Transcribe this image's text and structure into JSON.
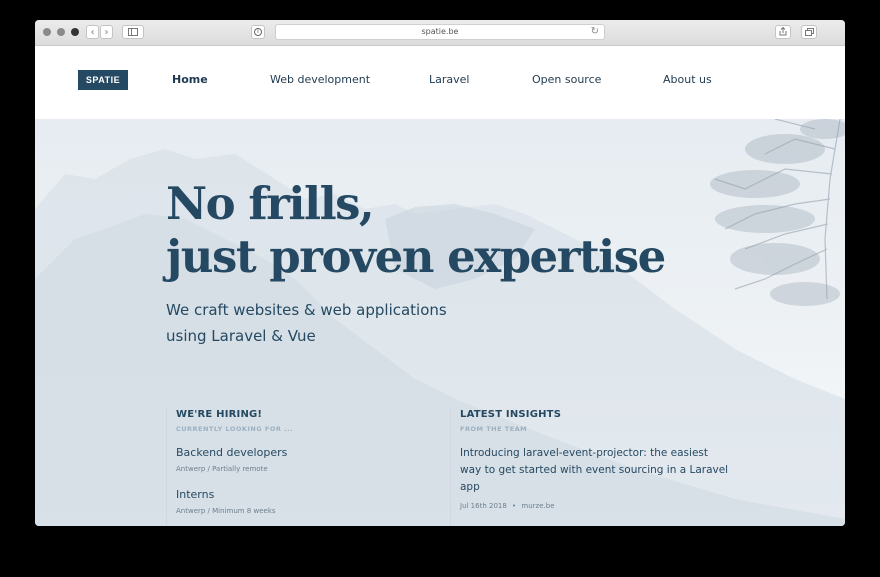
{
  "browser": {
    "url": "spatie.be",
    "back_icon": "chevron-left-icon",
    "forward_icon": "chevron-right-icon"
  },
  "site": {
    "logo": "SPATIE",
    "nav": [
      {
        "label": "Home",
        "active": true
      },
      {
        "label": "Web development",
        "active": false
      },
      {
        "label": "Laravel",
        "active": false
      },
      {
        "label": "Open source",
        "active": false
      },
      {
        "label": "About us",
        "active": false
      }
    ]
  },
  "hero": {
    "headline_line1": "No frills,",
    "headline_line2": "just proven expertise",
    "sub_line1": "We craft websites & web applications",
    "sub_line2": "using Laravel & Vue"
  },
  "hiring": {
    "title": "WE'RE HIRING!",
    "kicker": "CURRENTLY LOOKING FOR ...",
    "jobs": [
      {
        "title": "Backend developers",
        "meta": "Antwerp / Partially remote"
      },
      {
        "title": "Interns",
        "meta": "Antwerp / Minimum 8 weeks"
      }
    ]
  },
  "insights": {
    "title": "LATEST INSIGHTS",
    "kicker": "FROM THE TEAM",
    "post": {
      "title": "Introducing laravel-event-projector: the easiest way to get started with event sourcing in a Laravel app",
      "date": "Jul 16th 2018",
      "separator": "•",
      "source": "murze.be"
    }
  },
  "colors": {
    "brand": "#254962",
    "hero_bg": "#e6ecf1"
  }
}
